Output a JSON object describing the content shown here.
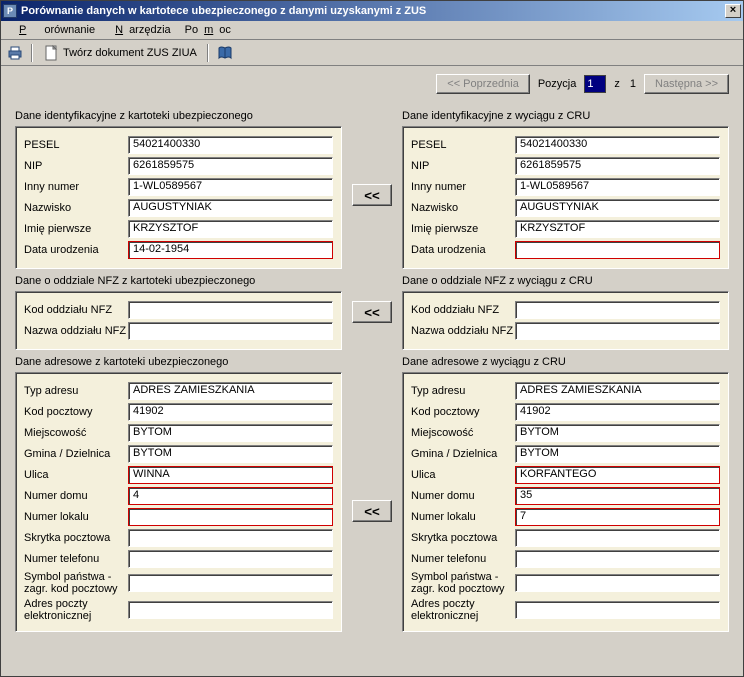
{
  "window": {
    "title": "Porównanie danych w kartotece ubezpieczonego z danymi uzyskanymi z ZUS",
    "close": "×"
  },
  "menu": {
    "porownanie": "Porównanie",
    "narzedzia": "Narzędzia",
    "pomoc": "Pomoc"
  },
  "toolbar": {
    "create_doc": "Twórz dokument ZUS ZIUA"
  },
  "nav": {
    "prev": "<< Poprzednia",
    "pozycja": "Pozycja",
    "pos_value": "1",
    "z": "z",
    "total": "1",
    "next": "Następna >>"
  },
  "arrows": {
    "copy": "<<"
  },
  "sections": {
    "ident_left_title": "Dane identyfikacyjne z kartoteki ubezpieczonego",
    "ident_right_title": "Dane identyfikacyjne z wyciągu z CRU",
    "nfz_left_title": "Dane o oddziale NFZ z kartoteki ubezpieczonego",
    "nfz_right_title": "Dane o oddziale NFZ z wyciągu z CRU",
    "addr_left_title": "Dane adresowe z kartoteki ubezpieczonego",
    "addr_right_title": "Dane adresowe z wyciągu z CRU"
  },
  "labels": {
    "pesel": "PESEL",
    "nip": "NIP",
    "inny_numer": "Inny numer",
    "nazwisko": "Nazwisko",
    "imie": "Imię pierwsze",
    "data_ur": "Data urodzenia",
    "kod_nfz": "Kod oddziału NFZ",
    "nazwa_nfz": "Nazwa oddziału NFZ",
    "typ_adresu": "Typ adresu",
    "kod_poczt": "Kod pocztowy",
    "miejscowosc": "Miejscowość",
    "gmina": "Gmina / Dzielnica",
    "ulica": "Ulica",
    "nr_domu": "Numer domu",
    "nr_lokalu": "Numer lokalu",
    "skrytka": "Skrytka pocztowa",
    "telefon": "Numer telefonu",
    "symbol_panstwa": "Symbol państwa - zagr. kod pocztowy",
    "email": "Adres poczty elektronicznej"
  },
  "left": {
    "pesel": "54021400330",
    "nip": "6261859575",
    "inny_numer": "1-WL0589567",
    "nazwisko": "AUGUSTYNIAK",
    "imie": "KRZYSZTOF",
    "data_ur": "14-02-1954",
    "kod_nfz": "",
    "nazwa_nfz": "",
    "typ_adresu": "ADRES ZAMIESZKANIA",
    "kod_poczt": "41902",
    "miejscowosc": "BYTOM",
    "gmina": "BYTOM",
    "ulica": "WINNA",
    "nr_domu": "4",
    "nr_lokalu": "",
    "skrytka": "",
    "telefon": "",
    "symbol_panstwa": "",
    "email": ""
  },
  "right": {
    "pesel": "54021400330",
    "nip": "6261859575",
    "inny_numer": "1-WL0589567",
    "nazwisko": "AUGUSTYNIAK",
    "imie": "KRZYSZTOF",
    "data_ur": "",
    "kod_nfz": "",
    "nazwa_nfz": "",
    "typ_adresu": "ADRES ZAMIESZKANIA",
    "kod_poczt": "41902",
    "miejscowosc": "BYTOM",
    "gmina": "BYTOM",
    "ulica": "KORFANTEGO",
    "nr_domu": "35",
    "nr_lokalu": "7",
    "skrytka": "",
    "telefon": "",
    "symbol_panstwa": "",
    "email": ""
  }
}
